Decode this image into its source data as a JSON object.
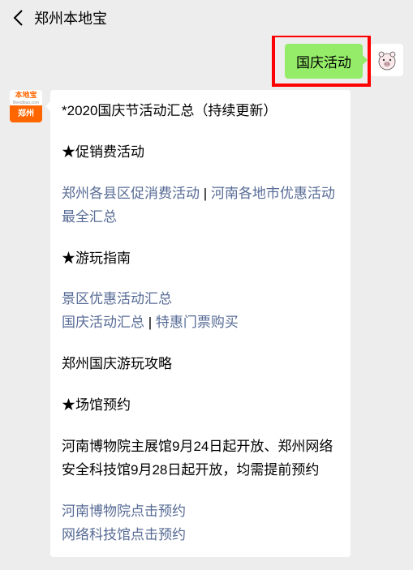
{
  "header": {
    "title": "郑州本地宝"
  },
  "sent": {
    "text": "国庆活动"
  },
  "avatar_receiver": {
    "brand_top": "本地宝",
    "brand_sub": "Bendibao.com",
    "brand_bottom": "郑州"
  },
  "msg": {
    "title": "*2020国庆节活动汇总（持续更新）",
    "section1_head": "★促销费活动",
    "link1a": "郑州各县区促消费活动",
    "sep": " | ",
    "link1b": "河南各地市优惠活动最全汇总",
    "section2_head": "★游玩指南",
    "link2a": "景区优惠活动汇总",
    "link2b": "国庆活动汇总",
    "link2c": "特惠门票购买",
    "text2": "郑州国庆游玩攻略",
    "section3_head": "★场馆预约",
    "text3": "河南博物院主展馆9月24日起开放、郑州网络安全科技馆9月28日起开放，均需提前预约",
    "link3a": "河南博物院点击预约",
    "link3b": "网络科技馆点击预约"
  }
}
